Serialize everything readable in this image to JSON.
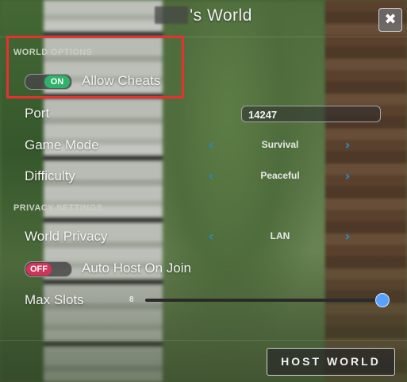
{
  "dialog": {
    "title": "'s World",
    "close_icon": "close-icon"
  },
  "world_options": {
    "section_label": "WORLD OPTIONS",
    "allow_cheats": {
      "label": "Allow Cheats",
      "toggle_text": "ON",
      "state": "on"
    },
    "port": {
      "label": "Port",
      "value": "14247"
    },
    "game_mode": {
      "label": "Game Mode",
      "value": "Survival"
    },
    "difficulty": {
      "label": "Difficulty",
      "value": "Peaceful"
    }
  },
  "privacy_settings": {
    "section_label": "PRIVACY SETTINGS",
    "world_privacy": {
      "label": "World Privacy",
      "value": "LAN"
    },
    "auto_host": {
      "label": "Auto Host On Join",
      "toggle_text": "OFF",
      "state": "off"
    },
    "max_slots": {
      "label": "Max Slots",
      "value": "8"
    }
  },
  "footer": {
    "host_button": "HOST WORLD"
  },
  "colors": {
    "accent_blue": "#2a89c9",
    "toggle_on": "#2fb36a",
    "toggle_off": "#d1335b",
    "highlight_box": "#e7312f"
  }
}
